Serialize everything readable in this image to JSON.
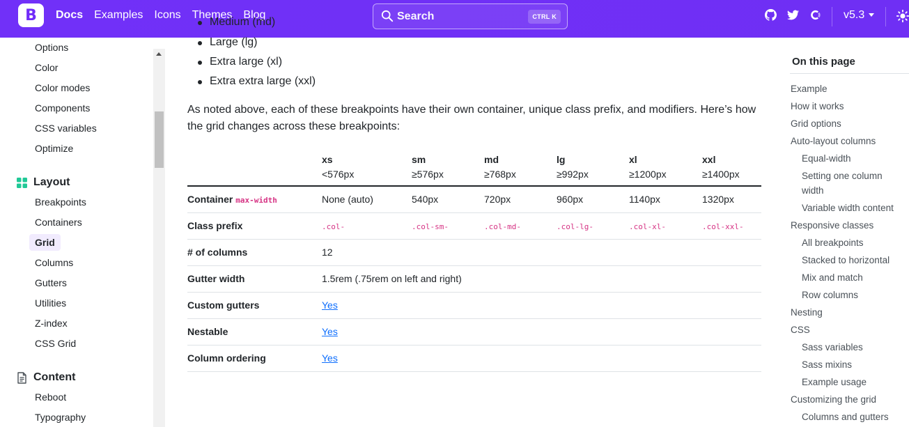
{
  "navbar": {
    "brand": "B",
    "links": [
      {
        "label": "Docs",
        "active": true
      },
      {
        "label": "Examples"
      },
      {
        "label": "Icons"
      },
      {
        "label": "Themes"
      },
      {
        "label": "Blog"
      }
    ],
    "search_label": "Search",
    "search_shortcut": "CTRL K",
    "version": "v5.3",
    "icons": [
      "github-icon",
      "twitter-icon",
      "opencollective-icon",
      "theme-sun-icon"
    ],
    "color": "#712cf9"
  },
  "sidebar": {
    "partial_item": "Options",
    "customize_items": [
      "Color",
      "Color modes",
      "Components",
      "CSS variables",
      "Optimize"
    ],
    "layout_heading": "Layout",
    "layout_items": [
      "Breakpoints",
      "Containers",
      "Grid",
      "Columns",
      "Gutters",
      "Utilities",
      "Z-index",
      "CSS Grid"
    ],
    "active_item": "Grid",
    "content_heading": "Content",
    "content_items": [
      "Reboot",
      "Typography"
    ]
  },
  "main": {
    "partial_bullet": "Medium (md)",
    "bullets": [
      "Large (lg)",
      "Extra large (xl)",
      "Extra extra large (xxl)"
    ],
    "paragraph": "As noted above, each of these breakpoints have their own container, unique class prefix, and modifiers. Here’s how the grid changes across these breakpoints:",
    "table": {
      "breakpoints": [
        {
          "name": "xs",
          "size": "<576px"
        },
        {
          "name": "sm",
          "size": "≥576px"
        },
        {
          "name": "md",
          "size": "≥768px"
        },
        {
          "name": "lg",
          "size": "≥992px"
        },
        {
          "name": "xl",
          "size": "≥1200px"
        },
        {
          "name": "xxl",
          "size": "≥1400px"
        }
      ],
      "container_label": "Container",
      "container_code": "max-width",
      "container_values": [
        "None (auto)",
        "540px",
        "720px",
        "960px",
        "1140px",
        "1320px"
      ],
      "class_prefix_label": "Class prefix",
      "class_prefixes": [
        ".col-",
        ".col-sm-",
        ".col-md-",
        ".col-lg-",
        ".col-xl-",
        ".col-xxl-"
      ],
      "columns_label": "# of columns",
      "columns_value": "12",
      "gutter_label": "Gutter width",
      "gutter_value": "1.5rem (.75rem on left and right)",
      "custom_gutters_label": "Custom gutters",
      "custom_gutters_value": "Yes",
      "nestable_label": "Nestable",
      "nestable_value": "Yes",
      "ordering_label": "Column ordering",
      "ordering_value": "Yes"
    }
  },
  "toc": {
    "title": "On this page",
    "items": [
      {
        "label": "Example",
        "level": 1
      },
      {
        "label": "How it works",
        "level": 1
      },
      {
        "label": "Grid options",
        "level": 1
      },
      {
        "label": "Auto-layout columns",
        "level": 1
      },
      {
        "label": "Equal-width",
        "level": 2
      },
      {
        "label": "Setting one column",
        "level": 2
      },
      {
        "label": "width",
        "level": 2
      },
      {
        "label": "Variable width content",
        "level": 2
      },
      {
        "label": "Responsive classes",
        "level": 1
      },
      {
        "label": "All breakpoints",
        "level": 2
      },
      {
        "label": "Stacked to horizontal",
        "level": 2
      },
      {
        "label": "Mix and match",
        "level": 2
      },
      {
        "label": "Row columns",
        "level": 2
      },
      {
        "label": "Nesting",
        "level": 1
      },
      {
        "label": "CSS",
        "level": 1
      },
      {
        "label": "Sass variables",
        "level": 2
      },
      {
        "label": "Sass mixins",
        "level": 2
      },
      {
        "label": "Example usage",
        "level": 2
      },
      {
        "label": "Customizing the grid",
        "level": 1
      },
      {
        "label": "Columns and gutters",
        "level": 2
      }
    ]
  }
}
